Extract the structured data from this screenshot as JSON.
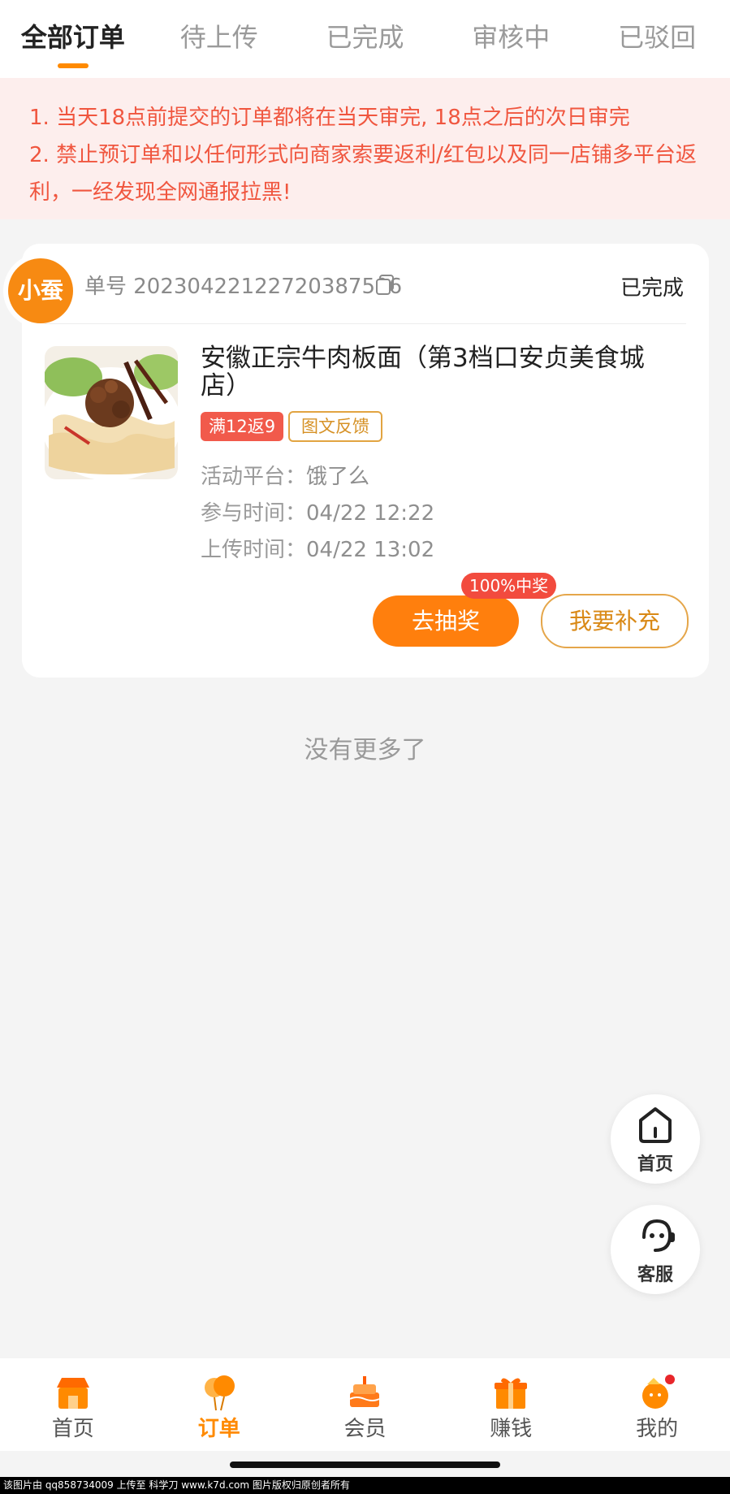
{
  "tabs": [
    {
      "label": "全部订单"
    },
    {
      "label": "待上传"
    },
    {
      "label": "已完成"
    },
    {
      "label": "审核中"
    },
    {
      "label": "已驳回"
    }
  ],
  "notice": {
    "line1": "1. 当天18点前提交的订单都将在当天审完, 18点之后的次日审完",
    "line2": "2. 禁止预订单和以任何形式向商家索要返利/红包以及同一店铺多平台返利，一经发现全网通报拉黑!"
  },
  "order": {
    "logo_text": "小蚕",
    "order_number": "单号 20230422122720387506",
    "status": "已完成",
    "title": "安徽正宗牛肉板面（第3档口安贞美食城店）",
    "tag_rebate": "满12返9",
    "tag_feedback": "图文反馈",
    "platform_label": "活动平台：",
    "platform_value": "饿了么",
    "join_label": "参与时间：",
    "join_value": "04/22 12:22",
    "upload_label": "上传时间：",
    "upload_value": "04/22 13:02",
    "lottery_badge": "100%中奖",
    "lottery_button": "去抽奖",
    "supplement_button": "我要补充"
  },
  "no_more": "没有更多了",
  "float_buttons": {
    "home": "首页",
    "service": "客服"
  },
  "bottom_nav": [
    {
      "label": "首页"
    },
    {
      "label": "订单"
    },
    {
      "label": "会员"
    },
    {
      "label": "赚钱"
    },
    {
      "label": "我的"
    }
  ],
  "footer_text": "该图片由 qq858734009 上传至 科学刀 www.k7d.com 图片版权归原创者所有",
  "colors": {
    "accent": "#ff8a00",
    "notice_bg": "#fdeeed",
    "notice_text": "#f0563f"
  }
}
